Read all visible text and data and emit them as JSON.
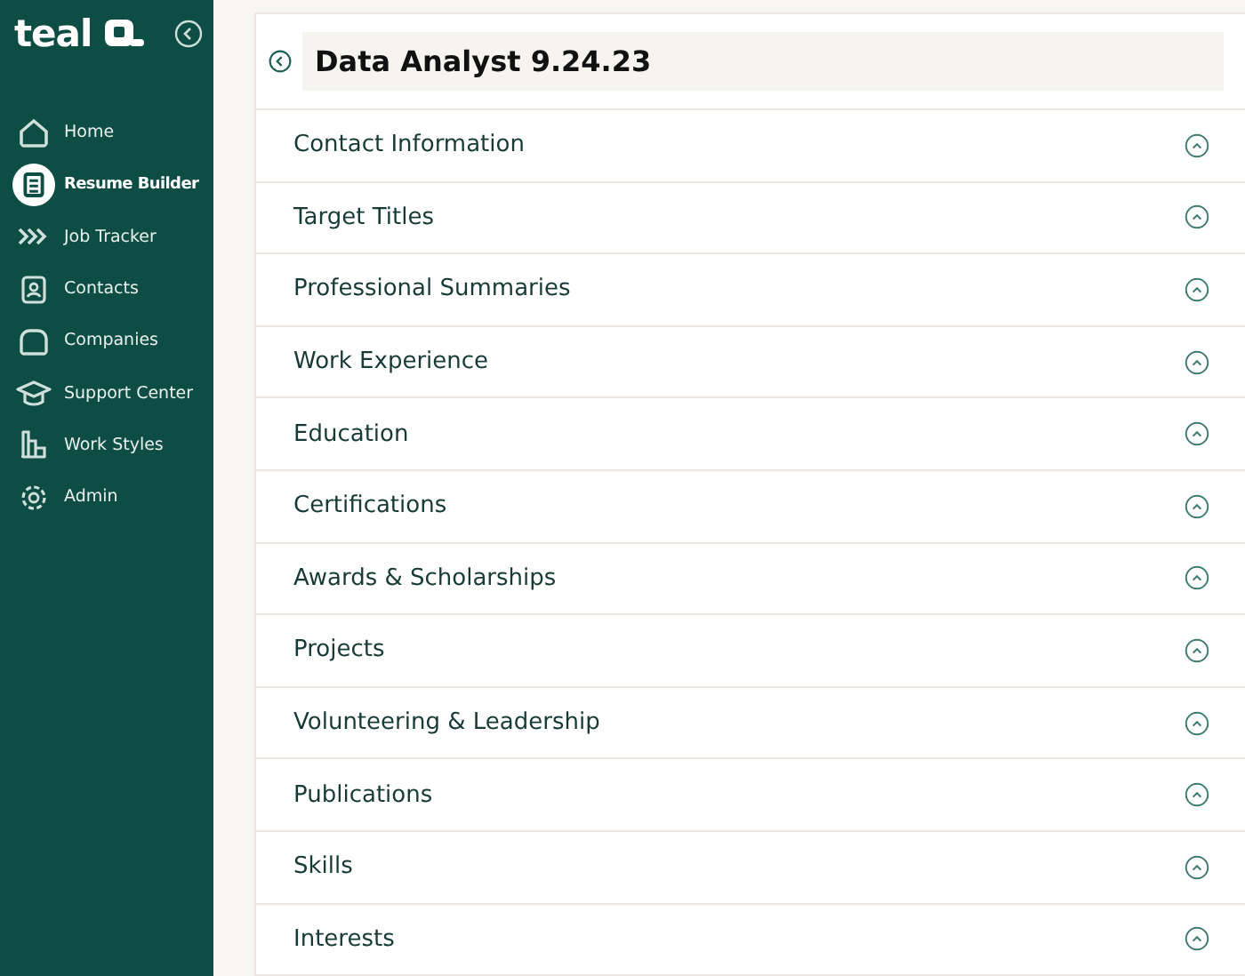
{
  "sidebar": {
    "logo": "teal",
    "items": [
      {
        "label": "Home",
        "selected": false
      },
      {
        "label": "Resume Builder",
        "selected": true
      },
      {
        "label": "Job Tracker",
        "selected": false
      },
      {
        "label": "Contacts",
        "selected": false
      },
      {
        "label": "Companies",
        "selected": false
      },
      {
        "label": "Support Center",
        "selected": false
      },
      {
        "label": "Work Styles",
        "selected": false
      },
      {
        "label": "Admin",
        "selected": false
      }
    ]
  },
  "resume": {
    "title": "Data Analyst 9.24.23",
    "sections": [
      "Contact Information",
      "Target Titles",
      "Professional Summaries",
      "Work Experience",
      "Education",
      "Certifications",
      "Awards & Scholarships",
      "Projects",
      "Volunteering & Leadership",
      "Publications",
      "Skills",
      "Interests"
    ]
  }
}
